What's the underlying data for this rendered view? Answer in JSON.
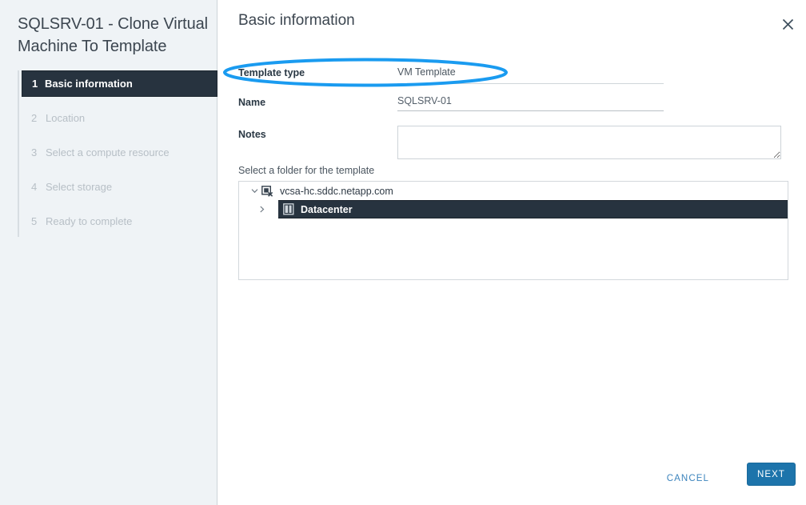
{
  "wizard": {
    "title": "SQLSRV-01 - Clone Virtual Machine To Template",
    "steps": [
      {
        "num": "1",
        "label": "Basic information",
        "state": "active"
      },
      {
        "num": "2",
        "label": "Location",
        "state": "inactive"
      },
      {
        "num": "3",
        "label": "Select a compute resource",
        "state": "inactive"
      },
      {
        "num": "4",
        "label": "Select storage",
        "state": "inactive"
      },
      {
        "num": "5",
        "label": "Ready to complete",
        "state": "inactive"
      }
    ]
  },
  "header": {
    "page_title": "Basic information",
    "close_icon": "close-icon"
  },
  "form": {
    "template_type": {
      "label": "Template type",
      "value": "VM Template"
    },
    "name": {
      "label": "Name",
      "value": "SQLSRV-01",
      "placeholder": ""
    },
    "notes": {
      "label": "Notes",
      "value": "",
      "placeholder": ""
    }
  },
  "folder_tree": {
    "section_label": "Select a folder for the template",
    "nodes": [
      {
        "label": "vcsa-hc.sddc.netapp.com",
        "icon": "vcenter-server-icon",
        "twisty": "chevron-down-icon",
        "expanded": true,
        "selected": false
      },
      {
        "label": "Datacenter",
        "icon": "datacenter-icon",
        "twisty": "chevron-right-icon",
        "expanded": false,
        "selected": true
      }
    ]
  },
  "footer": {
    "cancel_label": "CANCEL",
    "next_label": "NEXT"
  },
  "annotation": {
    "shape": "ellipse-highlight",
    "color": "#1a9bf0",
    "target": "template-type-row"
  },
  "colors": {
    "sidebar_background": "#eff3f6",
    "active_step_background": "#27333f",
    "selected_row_background": "#27333f",
    "primary_button": "#1d74ab",
    "link_text": "#3c84bd",
    "annotation_blue": "#1a9bf0"
  }
}
